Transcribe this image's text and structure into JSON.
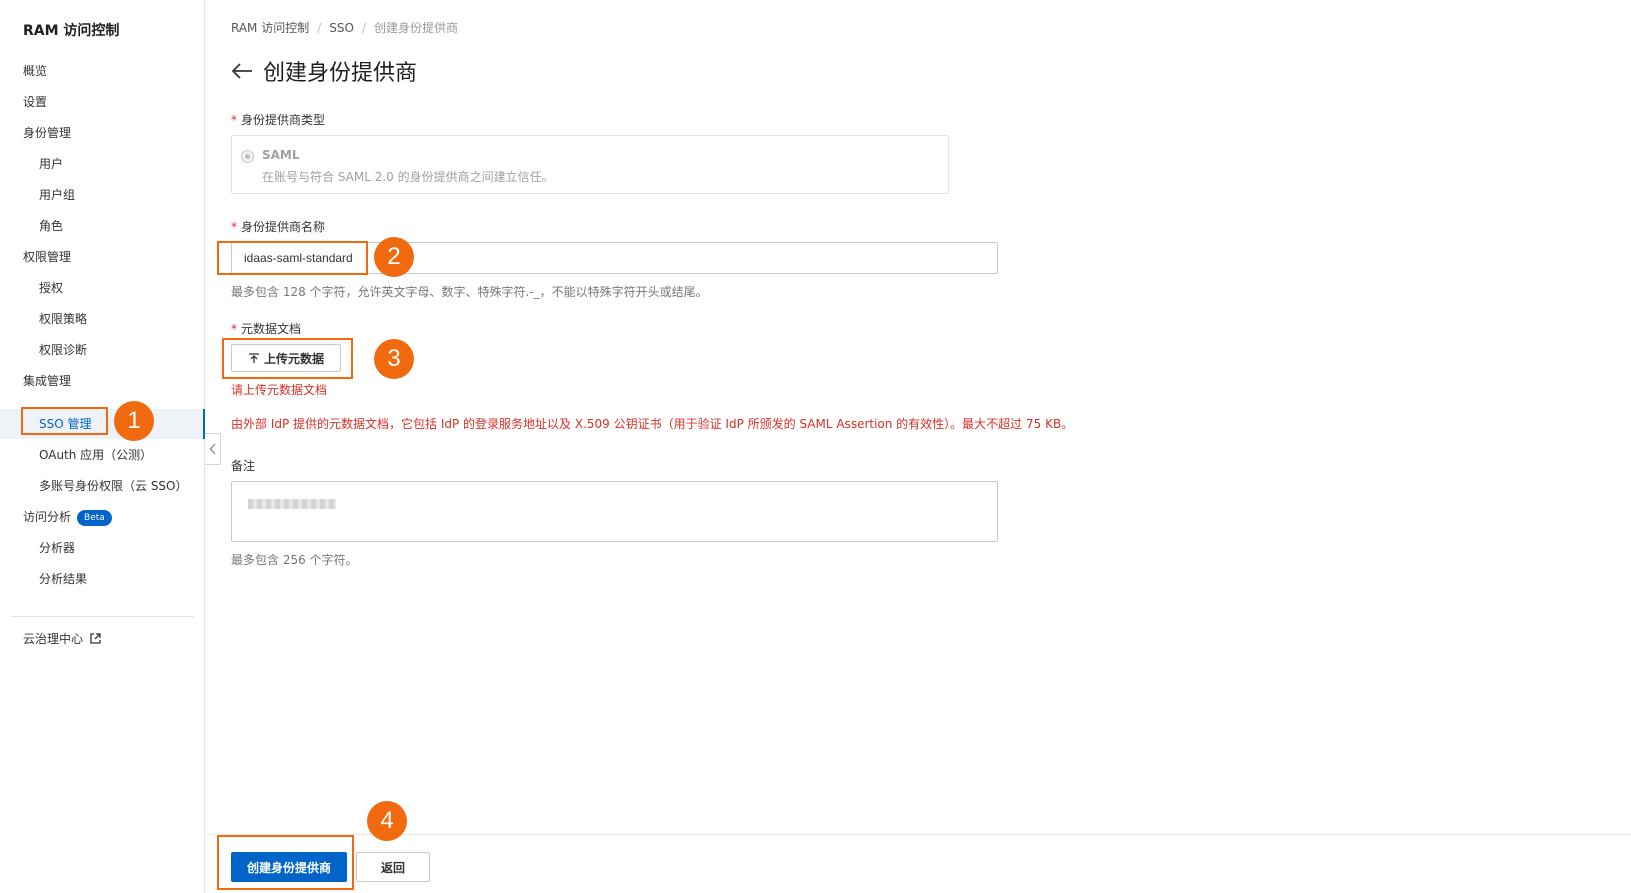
{
  "sidebar": {
    "title": "RAM 访问控制",
    "items": [
      {
        "label": "概览"
      },
      {
        "label": "设置"
      },
      {
        "label": "身份管理"
      },
      {
        "label": "用户"
      },
      {
        "label": "用户组"
      },
      {
        "label": "角色"
      },
      {
        "label": "权限管理"
      },
      {
        "label": "授权"
      },
      {
        "label": "权限策略"
      },
      {
        "label": "权限诊断"
      },
      {
        "label": "集成管理"
      },
      {
        "label": "SSO 管理"
      },
      {
        "label": "OAuth 应用（公测）"
      },
      {
        "label": "多账号身份权限（云 SSO）"
      },
      {
        "label": "访问分析",
        "badge": "Beta"
      },
      {
        "label": "分析器"
      },
      {
        "label": "分析结果"
      },
      {
        "label": "云治理中心"
      }
    ],
    "active_item": "SSO 管理"
  },
  "breadcrumb": [
    "RAM 访问控制",
    "SSO",
    "创建身份提供商"
  ],
  "page": {
    "title": "创建身份提供商"
  },
  "form": {
    "type": {
      "label": "身份提供商类型",
      "option_name": "SAML",
      "option_desc": "在账号与符合 SAML 2.0 的身份提供商之间建立信任。"
    },
    "name": {
      "label": "身份提供商名称",
      "value": "idaas-saml-standard",
      "hint": "最多包含 128 个字符，允许英文字母、数字、特殊字符.-_，不能以特殊字符开头或结尾。"
    },
    "metadata": {
      "label": "元数据文档",
      "upload_label": "上传元数据",
      "error": "请上传元数据文档",
      "desc": "由外部 IdP 提供的元数据文档，它包括 IdP 的登录服务地址以及 X.509 公钥证书（用于验证 IdP 所颁发的 SAML Assertion 的有效性）。最大不超过 75 KB。"
    },
    "remark": {
      "label": "备注",
      "hint": "最多包含 256 个字符。"
    }
  },
  "footer": {
    "create_label": "创建身份提供商",
    "back_label": "返回"
  },
  "annotations": [
    "1",
    "2",
    "3",
    "4"
  ],
  "colors": {
    "accent": "#0064c8",
    "annotation": "#f26a10",
    "error": "#d93026"
  }
}
